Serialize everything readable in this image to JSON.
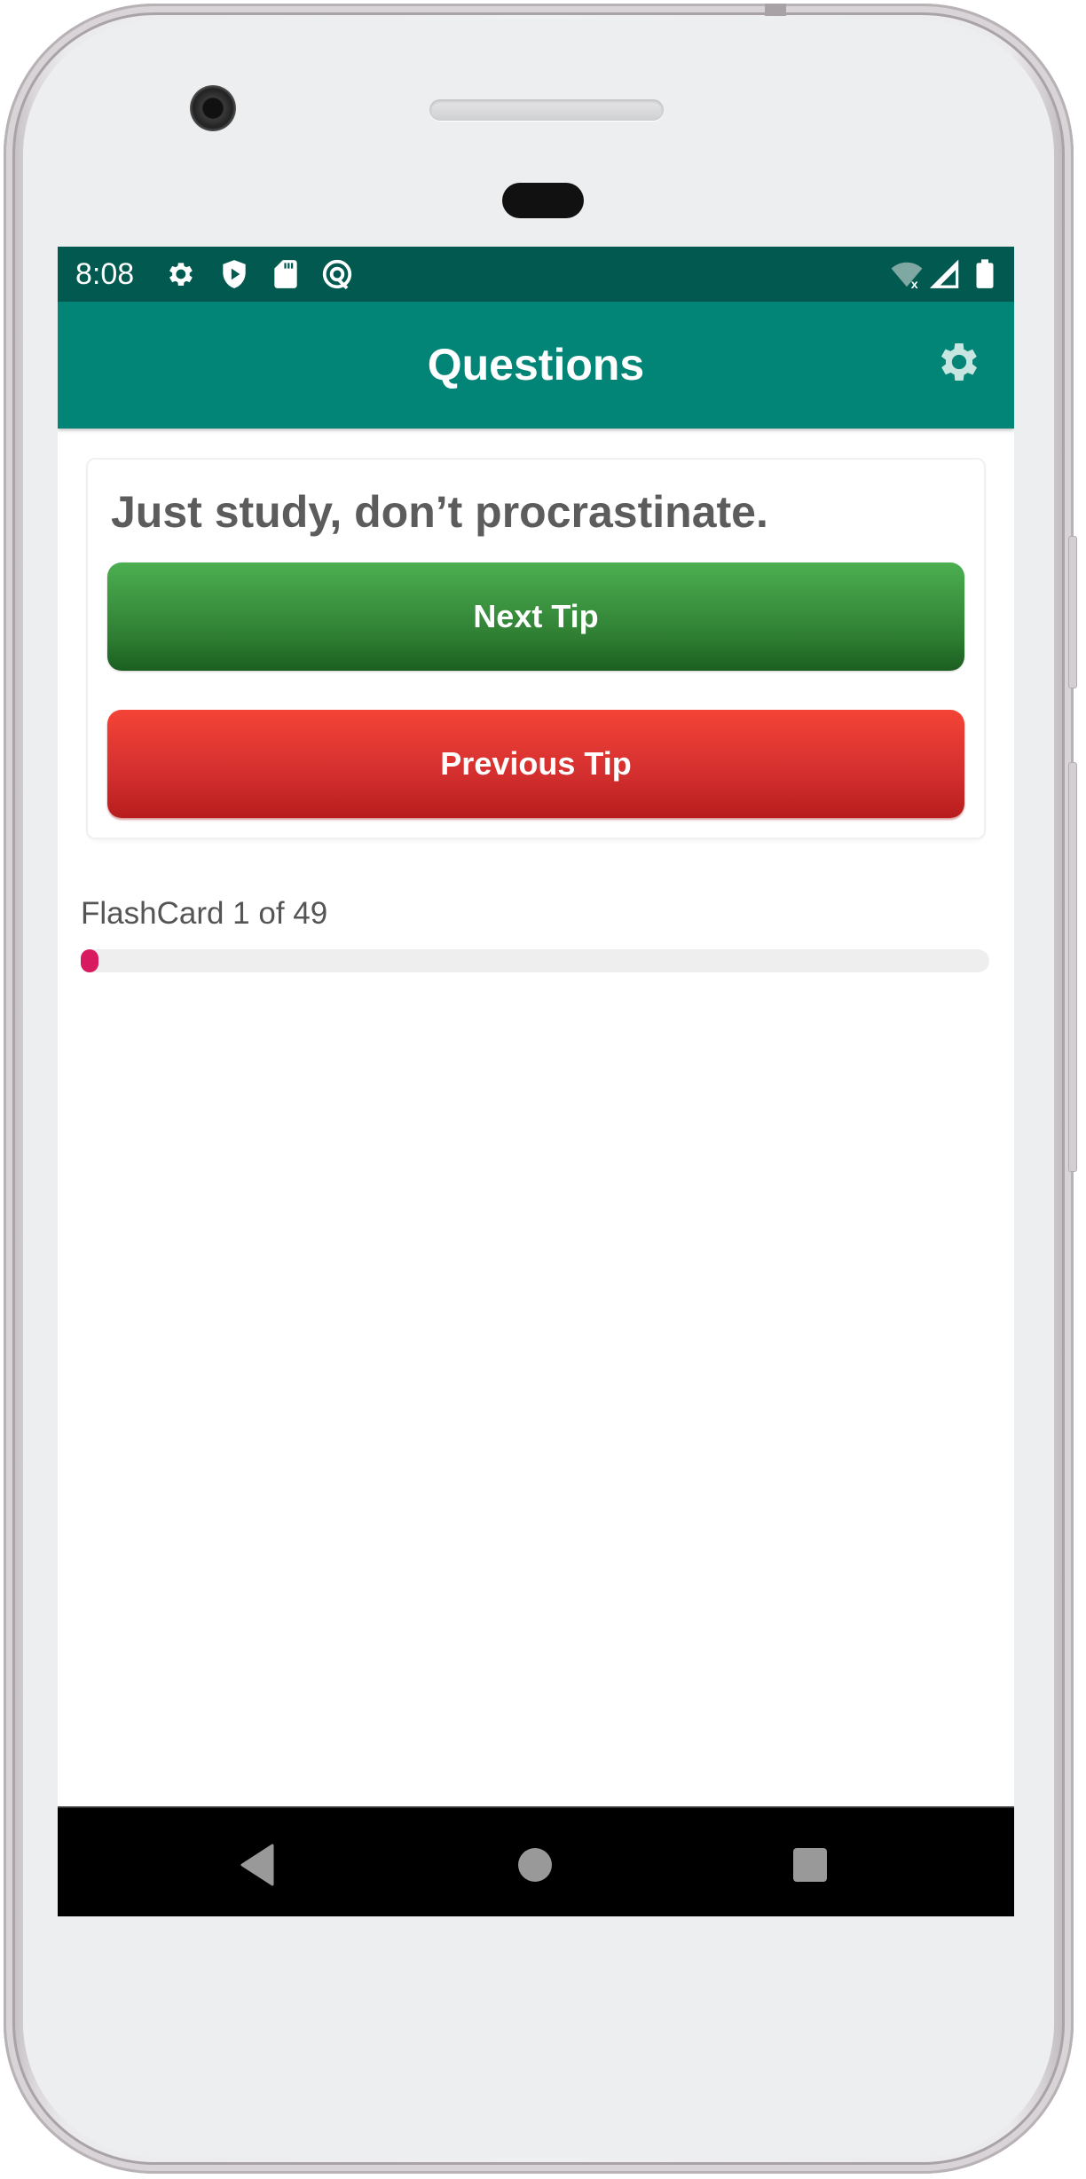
{
  "status_bar": {
    "time": "8:08",
    "left_icons": [
      "settings-icon",
      "shield-play-icon",
      "sd-card-icon",
      "at-sign-icon"
    ],
    "right_icons": [
      "wifi-no-internet-icon",
      "cellular-signal-icon",
      "battery-icon"
    ]
  },
  "app_bar": {
    "title": "Questions",
    "action_icon": "settings-gear-icon"
  },
  "tip_card": {
    "tip_text": "Just study, don’t procrastinate.",
    "next_button": "Next Tip",
    "previous_button": "Previous Tip"
  },
  "progress": {
    "label": "FlashCard 1 of 49",
    "current": 1,
    "total": 49,
    "color": "#d81b60"
  },
  "nav_bar": {
    "buttons": [
      "back",
      "home",
      "recents"
    ]
  },
  "colors": {
    "status_bar": "#01594f",
    "app_bar": "#028476",
    "next_button": "#388e3c",
    "previous_button": "#d32f2f"
  }
}
